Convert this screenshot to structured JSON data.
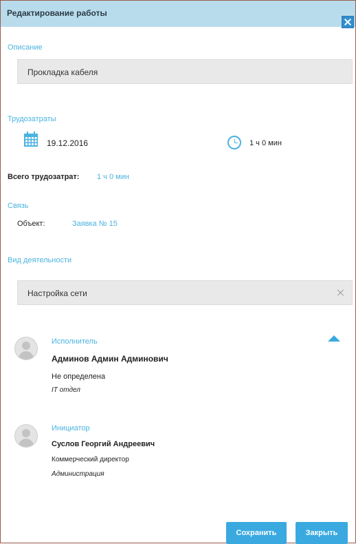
{
  "dialog": {
    "title": "Редактирование работы"
  },
  "description": {
    "label": "Описание",
    "value": "Прокладка кабеля"
  },
  "labor": {
    "label": "Трудозатраты",
    "date": "19.12.2016",
    "duration": "1 ч 0 мин",
    "total_label": "Всего трудозатрат:",
    "total_value": "1 ч 0 мин"
  },
  "links": {
    "label": "Связь",
    "object_label": "Объект:",
    "object_value": "Заявка № 15"
  },
  "activity": {
    "label": "Вид деятельности",
    "value": "Настройка сети"
  },
  "executor": {
    "role": "Исполнитель",
    "name": "Админов Админ Админович",
    "position": "Не определена",
    "department": "IT отдел"
  },
  "initiator": {
    "role": "Инициатор",
    "name": "Суслов Георгий Андреевич",
    "position": "Коммерческий директор",
    "department": "Администрация"
  },
  "buttons": {
    "save": "Сохранить",
    "close": "Закрыть"
  },
  "colors": {
    "accent": "#3aa9e0",
    "titlebar": "#b9dcec",
    "field_bg": "#e9e9e9"
  }
}
